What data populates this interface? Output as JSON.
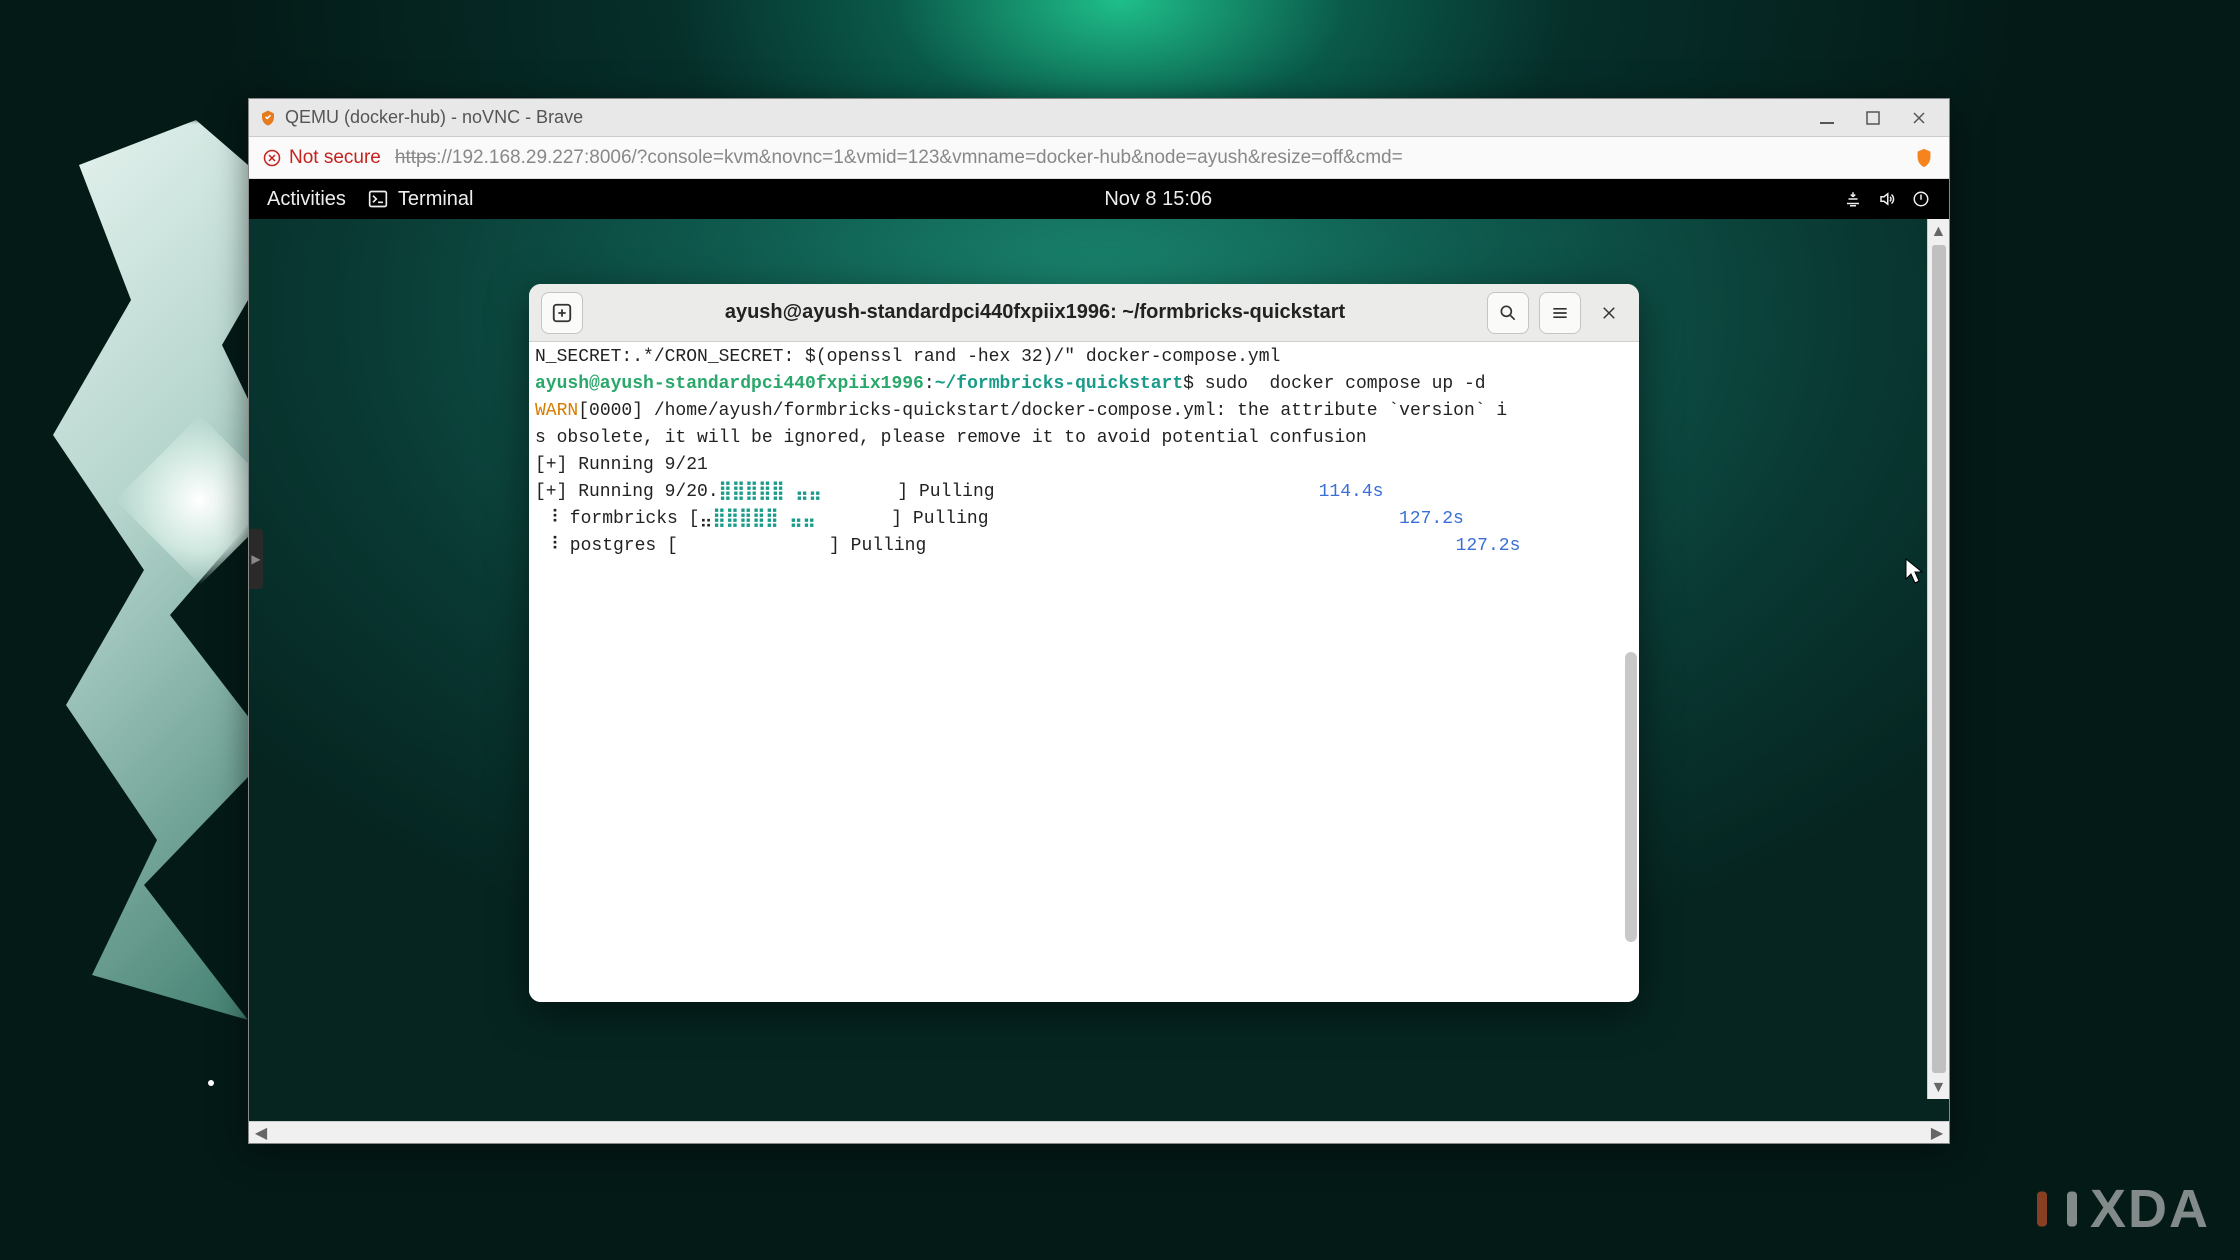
{
  "browser": {
    "tab_title": "QEMU (docker-hub) - noVNC - Brave",
    "not_secure_label": "Not secure",
    "url_scheme": "https",
    "url_rest": "://192.168.29.227:8006/?console=kvm&novnc=1&vmid=123&vmname=docker-hub&node=ayush&resize=off&cmd="
  },
  "gnome": {
    "activities": "Activities",
    "app_name": "Terminal",
    "clock": "Nov 8  15:06"
  },
  "terminal": {
    "title": "ayush@ayush-standardpci440fxpiix1996: ~/formbricks-quickstart",
    "line1": "N_SECRET:.*/CRON_SECRET: $(openssl rand -hex 32)/\" docker-compose.yml",
    "prompt_user": "ayush@ayush-standardpci440fxpiix1996",
    "prompt_sep": ":",
    "prompt_path": "~/formbricks-quickstart",
    "prompt_dollar": "$ ",
    "cmd": "sudo  docker compose up -d",
    "warn_tag": "WARN",
    "warn_rest": "[0000] /home/ayush/formbricks-quickstart/docker-compose.yml: the attribute `version` i",
    "warn_cont": "s obsolete, it will be ignored, please remove it to avoid potential confusion",
    "run1": "[+] Running 9/21",
    "run2_a": "[+] Running 9/20.",
    "run2_bar": "⣿⣿⣿⣿⣿ ⣤⣤",
    "run2_b": "       ] Pulling",
    "run2_time": "114.4s",
    "fb_a": " ⠸ formbricks [⣤",
    "fb_bar": "⣿⣿⣿⣿⣿ ⣤⣤",
    "fb_b": "       ] Pulling",
    "fb_time": "127.2s",
    "pg_a": " ⠸ postgres [",
    "pg_b": "              ] Pulling",
    "pg_time": "127.2s"
  },
  "watermark": {
    "text": "XDA"
  }
}
